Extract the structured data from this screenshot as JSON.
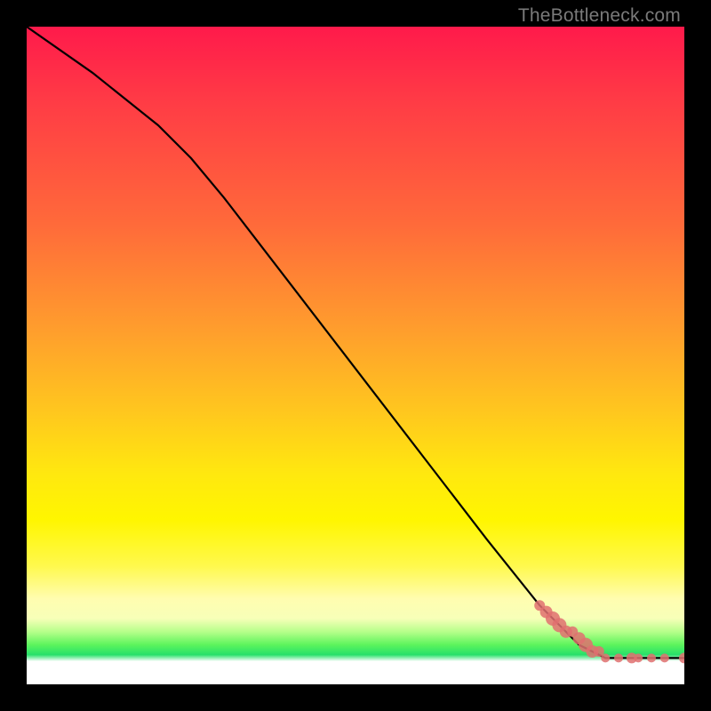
{
  "watermark": "TheBottleneck.com",
  "colors": {
    "frame": "#000000",
    "line": "#000000",
    "marker": "#e07070",
    "gradient_top": "#ff1a4b",
    "gradient_mid": "#ffe80f",
    "gradient_green": "#27e06a",
    "gradient_bottom": "#ffffff"
  },
  "chart_data": {
    "type": "line",
    "title": "",
    "xlabel": "",
    "ylabel": "",
    "xlim": [
      0,
      100
    ],
    "ylim": [
      0,
      100
    ],
    "grid": false,
    "legend": false,
    "series": [
      {
        "name": "curve",
        "x": [
          0,
          10,
          20,
          25,
          30,
          40,
          50,
          60,
          70,
          78,
          82,
          84,
          86,
          88,
          90,
          92,
          94,
          96,
          98,
          100
        ],
        "y": [
          100,
          93,
          85,
          80,
          74,
          61,
          48,
          35,
          22,
          12,
          8,
          6,
          5,
          4,
          4,
          4,
          4,
          4,
          4,
          4
        ]
      }
    ],
    "markers": {
      "name": "dots",
      "x": [
        78,
        79,
        80,
        81,
        82,
        83,
        84,
        85,
        86,
        87,
        88,
        90,
        92,
        93,
        95,
        97,
        100
      ],
      "y": [
        12,
        11,
        10,
        9,
        8,
        8,
        7,
        6,
        5,
        5,
        4,
        4,
        4,
        4,
        4,
        4,
        4
      ],
      "size": [
        6,
        7,
        8,
        8,
        7,
        6,
        7,
        8,
        7,
        6,
        5,
        5,
        6,
        5,
        5,
        5,
        6
      ]
    }
  }
}
